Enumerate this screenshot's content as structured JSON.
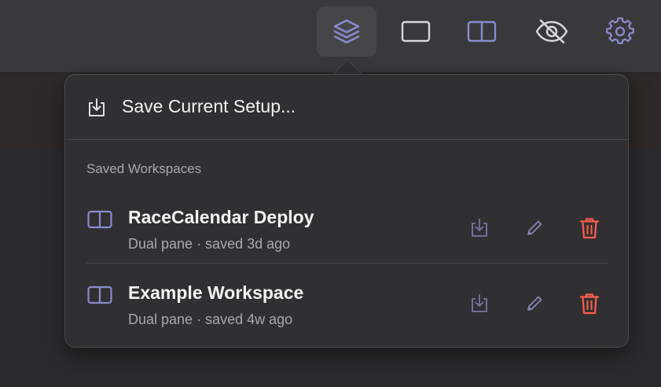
{
  "toolbar": {
    "buttons": [
      {
        "name": "workspaces-button",
        "icon": "layers-icon",
        "active": true
      },
      {
        "name": "single-pane-button",
        "icon": "single-pane-icon"
      },
      {
        "name": "dual-pane-button",
        "icon": "dual-pane-icon"
      },
      {
        "name": "hide-button",
        "icon": "eye-slash-icon"
      },
      {
        "name": "settings-button",
        "icon": "gear-icon"
      }
    ]
  },
  "popover": {
    "save_label": "Save Current Setup...",
    "section_title": "Saved Workspaces",
    "workspaces": [
      {
        "name": "RaceCalendar Deploy",
        "meta": "Dual pane · saved 3d ago"
      },
      {
        "name": "Example Workspace",
        "meta": "Dual pane · saved 4w ago"
      }
    ]
  },
  "colors": {
    "accent": "#8a8ad0",
    "danger": "#ff5c4d",
    "text": "#f2f2f2",
    "muted": "#a8a8ad"
  }
}
